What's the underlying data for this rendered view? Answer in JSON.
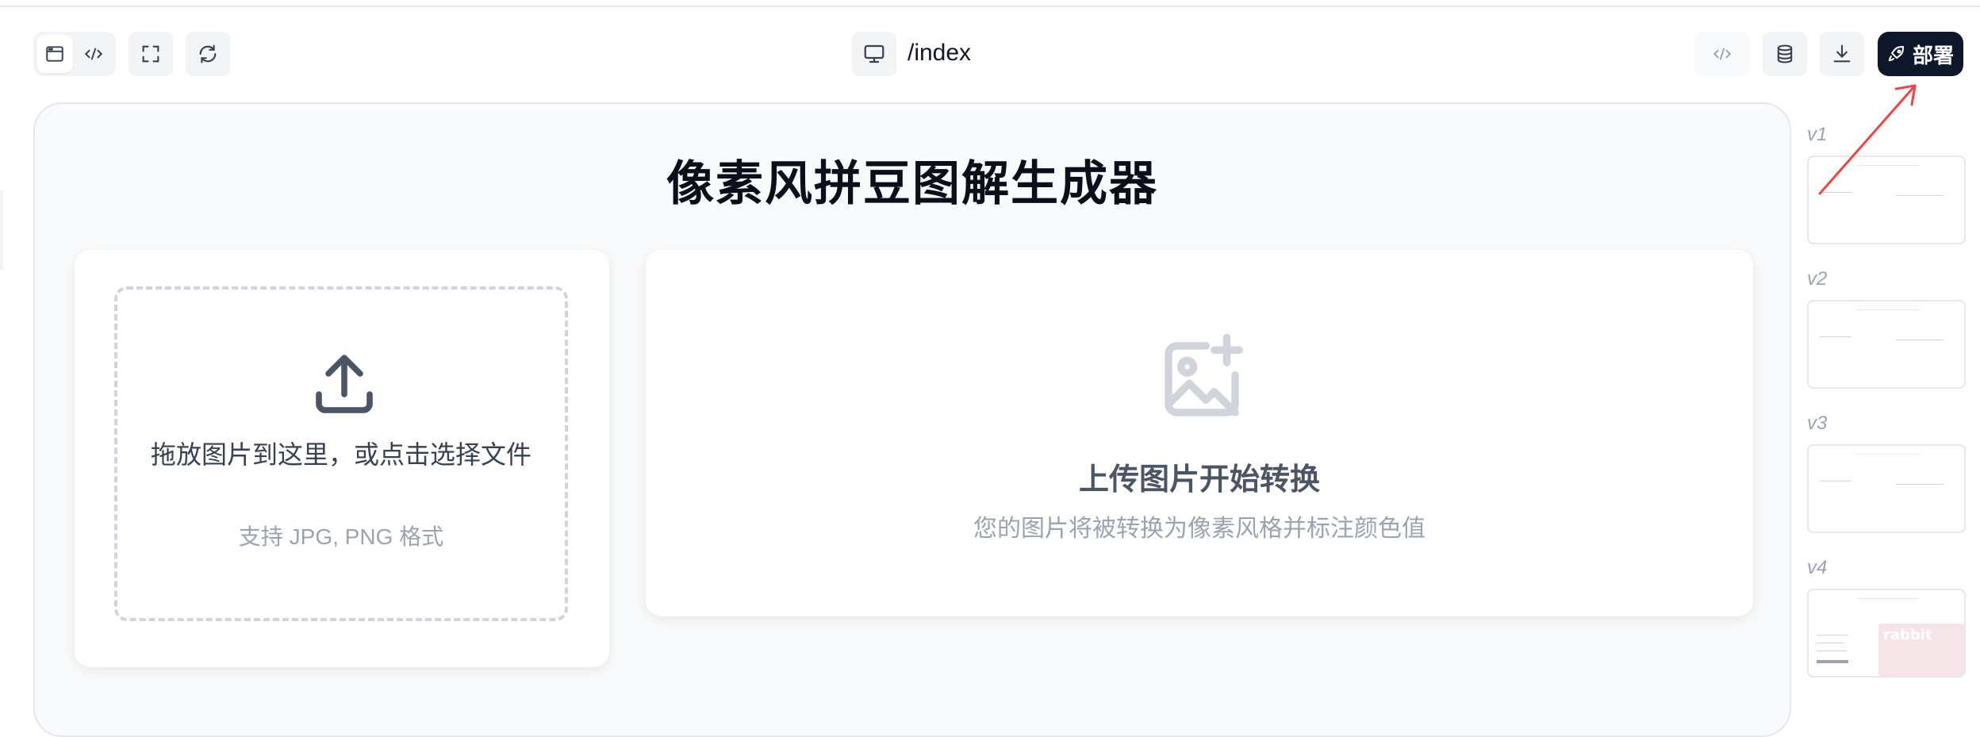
{
  "toolbar": {
    "route": "/index",
    "deploy_label": "部署"
  },
  "preview": {
    "title": "像素风拼豆图解生成器",
    "upload": {
      "text": "拖放图片到这里，或点击选择文件",
      "hint": "支持 JPG, PNG 格式"
    },
    "placeholder": {
      "title": "上传图片开始转换",
      "subtitle": "您的图片将被转换为像素风格并标注颜色值"
    }
  },
  "versions": [
    {
      "label": "v1"
    },
    {
      "label": "v2"
    },
    {
      "label": "v3"
    },
    {
      "label": "v4",
      "thumb_text": "rabbit"
    }
  ],
  "colors": {
    "deploy_bg": "#0f172a",
    "annotation_arrow": "#ef4444"
  },
  "icons": [
    "browser-window-icon",
    "code-icon",
    "fullscreen-icon",
    "refresh-icon",
    "monitor-icon",
    "code-icon",
    "database-icon",
    "download-icon",
    "rocket-icon",
    "upload-icon",
    "image-add-icon"
  ]
}
